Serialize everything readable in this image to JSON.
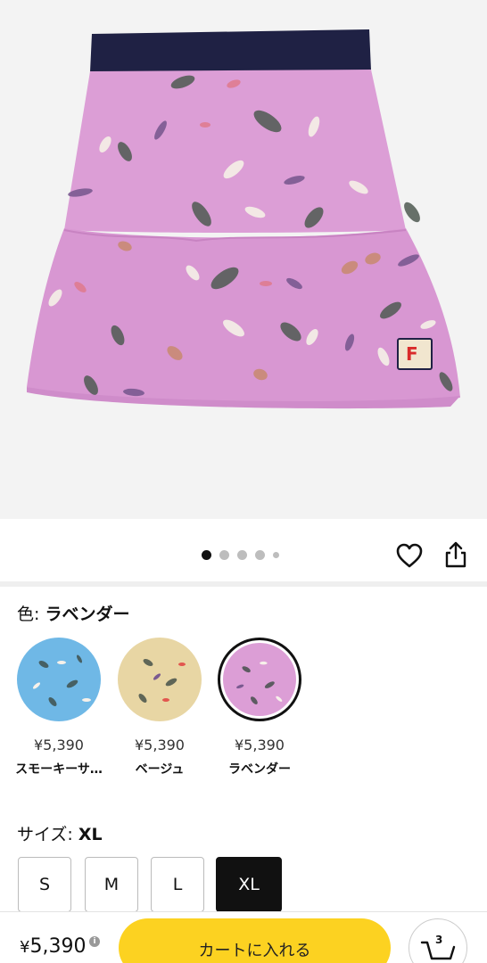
{
  "gallery": {
    "total_images": 5,
    "active_index": 1,
    "brand_mark": "F"
  },
  "color_section": {
    "label": "色: ",
    "selected": "ラベンダー",
    "swatches": [
      {
        "price": "¥5,390",
        "name": "スモーキーサ…",
        "color": "#6fb8e6",
        "selected": false
      },
      {
        "price": "¥5,390",
        "name": "ベージュ",
        "color": "#e8d6a4",
        "selected": false
      },
      {
        "price": "¥5,390",
        "name": "ラベンダー",
        "color": "#dc9ed6",
        "selected": true
      }
    ]
  },
  "size_section": {
    "label": "サイズ: ",
    "selected": "XL",
    "options": [
      "S",
      "M",
      "L",
      "XL"
    ]
  },
  "bottom_bar": {
    "price_symbol": "¥",
    "price_value": "5,390",
    "info_symbol": "i",
    "add_to_cart": "カートに入れる",
    "cart_count": "3"
  },
  "colors": {
    "accent_yellow": "#fcd221",
    "skirt_pink": "#dc9ed6",
    "waistband_navy": "#1f2144"
  },
  "icons": [
    "heart-icon",
    "share-icon",
    "info-icon",
    "cart-icon"
  ]
}
